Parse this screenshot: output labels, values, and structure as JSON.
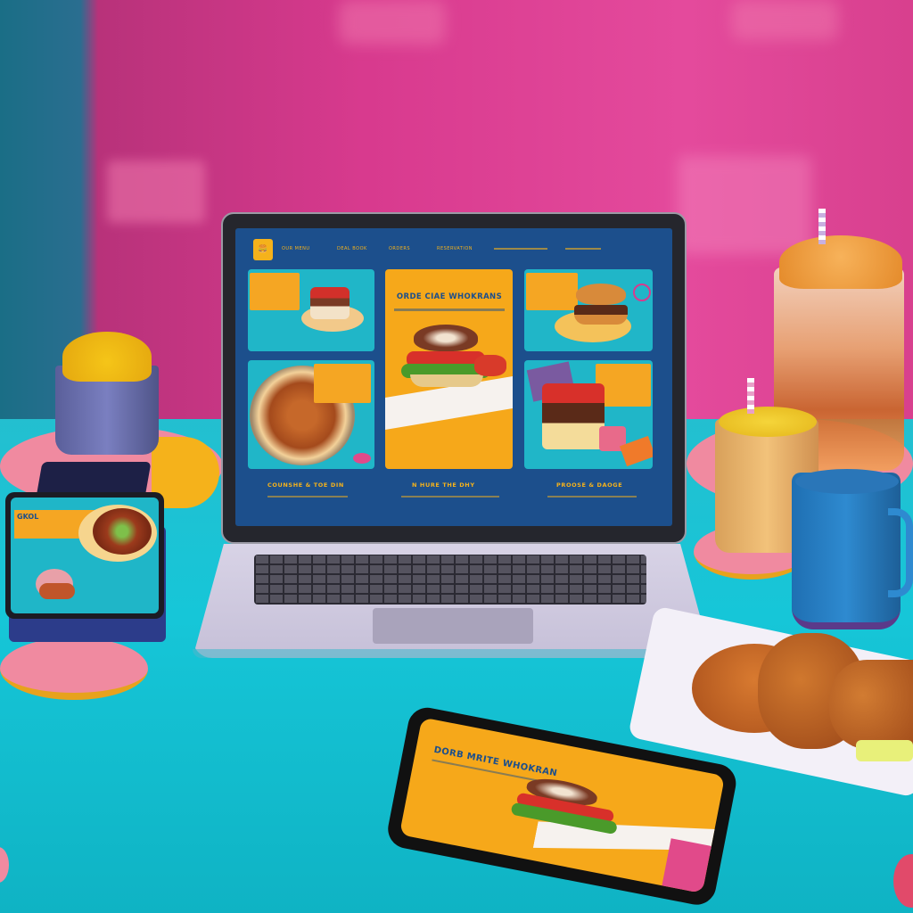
{
  "laptop_site": {
    "logo": "🍔",
    "nav": [
      "OUR MENU",
      "DEAL BOOK",
      "ORDERS",
      "RESERVATION"
    ],
    "hero_title": "ORDE CIAE WHOKRANS",
    "captions": [
      "COUNSHE & TOE DIN",
      "N HURE THE DHY",
      "PROOSE & DAOGE"
    ]
  },
  "phone_site": {
    "title": "DORB MRITE WHOKRAN"
  },
  "tablet_site": {
    "label": "GKOL"
  },
  "colors": {
    "wall_pink": "#e44a9c",
    "table_teal": "#16c6d8",
    "site_blue": "#1c4f8c",
    "site_orange": "#f6a81a"
  }
}
